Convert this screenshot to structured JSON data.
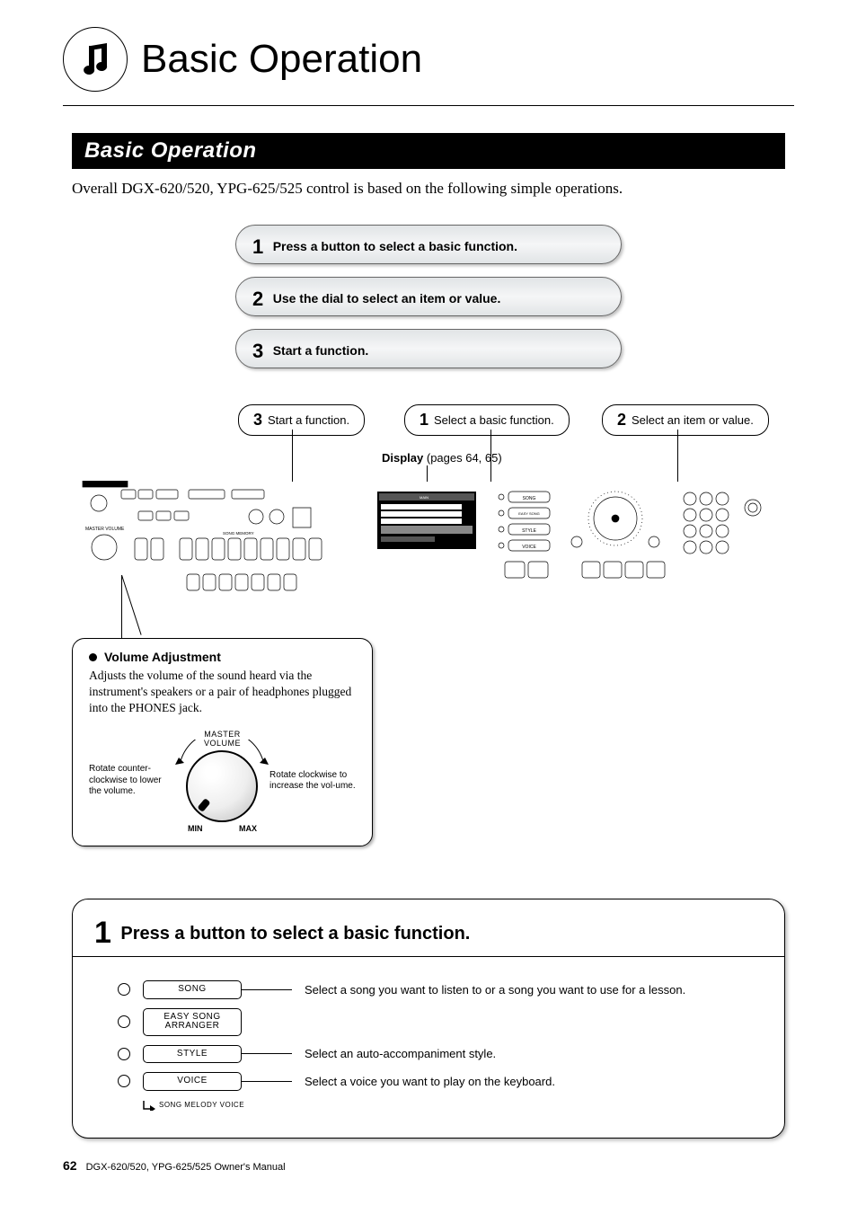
{
  "page_title": "Basic Operation",
  "section_bar": "Basic Operation",
  "intro": "Overall DGX-620/520, YPG-625/525 control is based on the following simple operations.",
  "steps": [
    {
      "num": "1",
      "text": "Press a button to select a basic function."
    },
    {
      "num": "2",
      "text": "Use the dial to select an item or value."
    },
    {
      "num": "3",
      "text": "Start a function."
    }
  ],
  "callouts": {
    "c3": {
      "num": "3",
      "text": "Start a function."
    },
    "c1": {
      "num": "1",
      "text": "Select a basic function."
    },
    "c2": {
      "num": "2",
      "text": "Select an item or value."
    }
  },
  "display_label": {
    "bold": "Display",
    "rest": " (pages 64, 65)"
  },
  "volume_box": {
    "title": "Volume Adjustment",
    "desc": "Adjusts the volume of the sound heard via the instrument's speakers or a pair of headphones plugged into the PHONES jack.",
    "left": "Rotate counter-clockwise to lower the volume.",
    "right": "Rotate clockwise to increase the vol-ume.",
    "dial_label": "MASTER VOLUME",
    "min": "MIN",
    "max": "MAX"
  },
  "step1": {
    "num": "1",
    "title": "Press a button to select a basic function.",
    "rows": [
      {
        "label": "SONG",
        "desc": "Select a song you want to listen to or a song you want to use for a lesson.",
        "conn": 56
      },
      {
        "label": "EASY SONG\nARRANGER",
        "desc": "",
        "conn": 0
      },
      {
        "label": "STYLE",
        "desc": "Select an auto-accompaniment style.",
        "conn": 56
      },
      {
        "label": "VOICE",
        "desc": "Select a voice you want to play on the keyboard.",
        "conn": 56
      }
    ],
    "smv": "SONG MELODY VOICE"
  },
  "footer": {
    "page": "62",
    "manual": "DGX-620/520, YPG-625/525  Owner's Manual"
  }
}
